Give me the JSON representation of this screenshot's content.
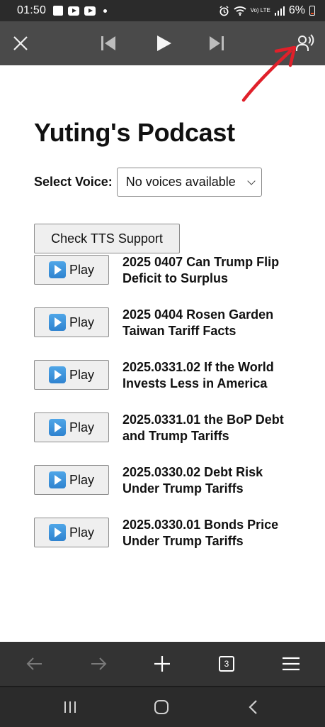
{
  "status_bar": {
    "time": "01:50",
    "battery": "6%",
    "icons": [
      "notification-card-icon",
      "youtube-icon",
      "youtube-icon",
      "dot-icon",
      "alarm-icon",
      "wifi-icon",
      "volte-icon",
      "signal-icon",
      "battery-icon"
    ],
    "network_small": "Vo) LTE"
  },
  "media_bar": {
    "icons": [
      "close-icon",
      "skip-previous-icon",
      "play-icon",
      "skip-next-icon",
      "voice-reader-icon"
    ]
  },
  "page": {
    "title": "Yuting's Podcast",
    "voice_label": "Select Voice:",
    "voice_selected": "No voices available",
    "check_button": "Check TTS Support"
  },
  "episodes": [
    {
      "play_label": "Play",
      "title": "2025 0407 Can Trump Flip Deficit to Surplus"
    },
    {
      "play_label": "Play",
      "title": "2025 0404 Rosen Garden Taiwan Tariff Facts"
    },
    {
      "play_label": "Play",
      "title": "2025.0331.02 If the World Invests Less in America"
    },
    {
      "play_label": "Play",
      "title": "2025.0331.01 the BoP Debt and Trump Tariffs"
    },
    {
      "play_label": "Play",
      "title": "2025.0330.02 Debt Risk Under Trump Tariffs"
    },
    {
      "play_label": "Play",
      "title": "2025.0330.01 Bonds Price Under Trump Tariffs"
    }
  ],
  "bottom_bar": {
    "tab_count": "3",
    "icons": [
      "back-arrow-icon",
      "forward-arrow-icon",
      "plus-icon",
      "tabs-icon",
      "menu-icon"
    ]
  },
  "nav_bar": {
    "icons": [
      "recents-icon",
      "home-icon",
      "back-icon"
    ]
  },
  "colors": {
    "status_bar_bg": "#2b2b2b",
    "media_bar_bg": "#4a4a4a",
    "bottom_bar_bg": "#333333",
    "annotation_arrow": "#e0202a",
    "button_bg": "#efefef"
  }
}
